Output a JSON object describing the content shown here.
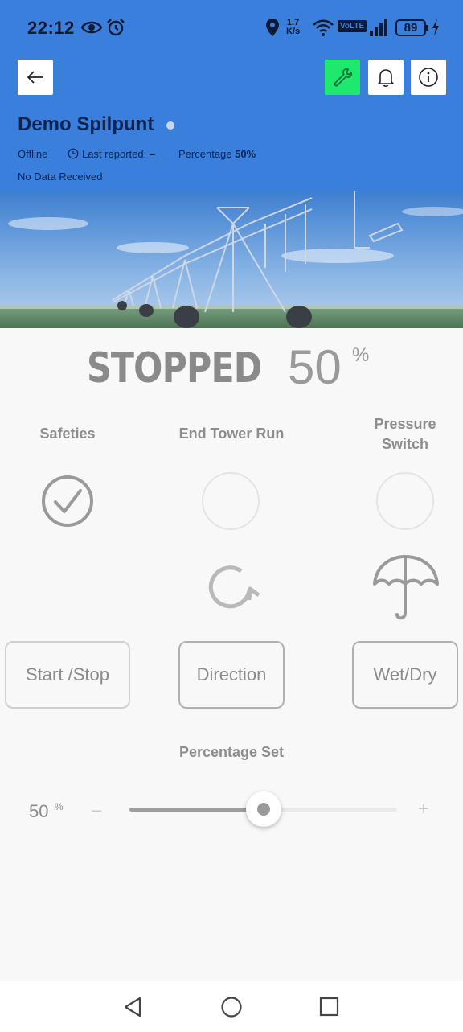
{
  "status_bar": {
    "time": "22:12",
    "net_speed_value": "1.7",
    "net_speed_unit": "K/s",
    "volte": "VoLTE",
    "battery": "89"
  },
  "header": {
    "device_name": "Demo Spilpunt",
    "connection": "Offline",
    "last_reported_label": "Last reported:",
    "last_reported_value": "–",
    "percentage_label": "Percentage",
    "percentage_value": "50%",
    "data_status": "No Data Received"
  },
  "pivot_status": {
    "state": "STOPPED",
    "percentage": "50",
    "percentage_unit": "%"
  },
  "indicators": {
    "safeties": "Safeties",
    "end_tower_run": "End Tower Run",
    "pressure_switch": "Pressure Switch"
  },
  "controls": {
    "start_stop": "Start /Stop",
    "direction": "Direction",
    "wet_dry": "Wet/Dry"
  },
  "percentage_set": {
    "label": "Percentage Set",
    "value": "50",
    "unit": "%",
    "minus": "–",
    "plus": "+",
    "level": 0.5
  },
  "colors": {
    "header_bg": "#3a7fdc",
    "wrench_button": "#1ee86e",
    "title_text": "#0d2350"
  },
  "icons": [
    "back-arrow-icon",
    "wrench-icon",
    "bell-icon",
    "info-icon",
    "check-circle-icon",
    "rotate-icon",
    "umbrella-icon"
  ]
}
